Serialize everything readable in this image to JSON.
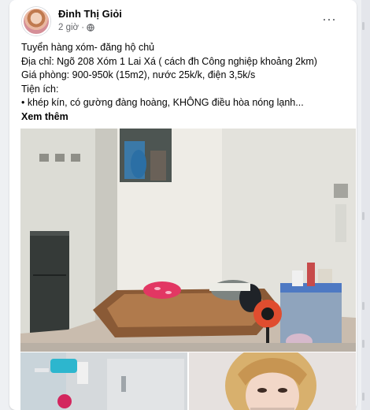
{
  "post": {
    "author_name": "Đinh Thị Giỏi",
    "time": "2 giờ ·",
    "more_options_label": "···",
    "text_lines": [
      "Tuyển hàng xóm- đăng hộ chủ",
      "Địa chỉ: Ngõ 208 Xóm 1 Lai Xá ( cách đh Công nghiệp khoảng 2km)",
      "Giá phòng: 900-950k (15m2), nước 25k/k, điện 3,5k/s",
      "Tiện ích:"
    ],
    "bullet_text": "• khép kín, có gường đàng hoàng, KHÔNG điều hòa nóng lạnh...",
    "see_more_label": "Xem thêm"
  },
  "icons": {
    "avatar": "profile-avatar",
    "privacy": "globe-icon",
    "more": "more-options-icon"
  },
  "colors": {
    "card_bg": "#ffffff",
    "feed_bg": "#eef0f3",
    "secondary_text": "#65676b",
    "primary_text": "#050505"
  }
}
